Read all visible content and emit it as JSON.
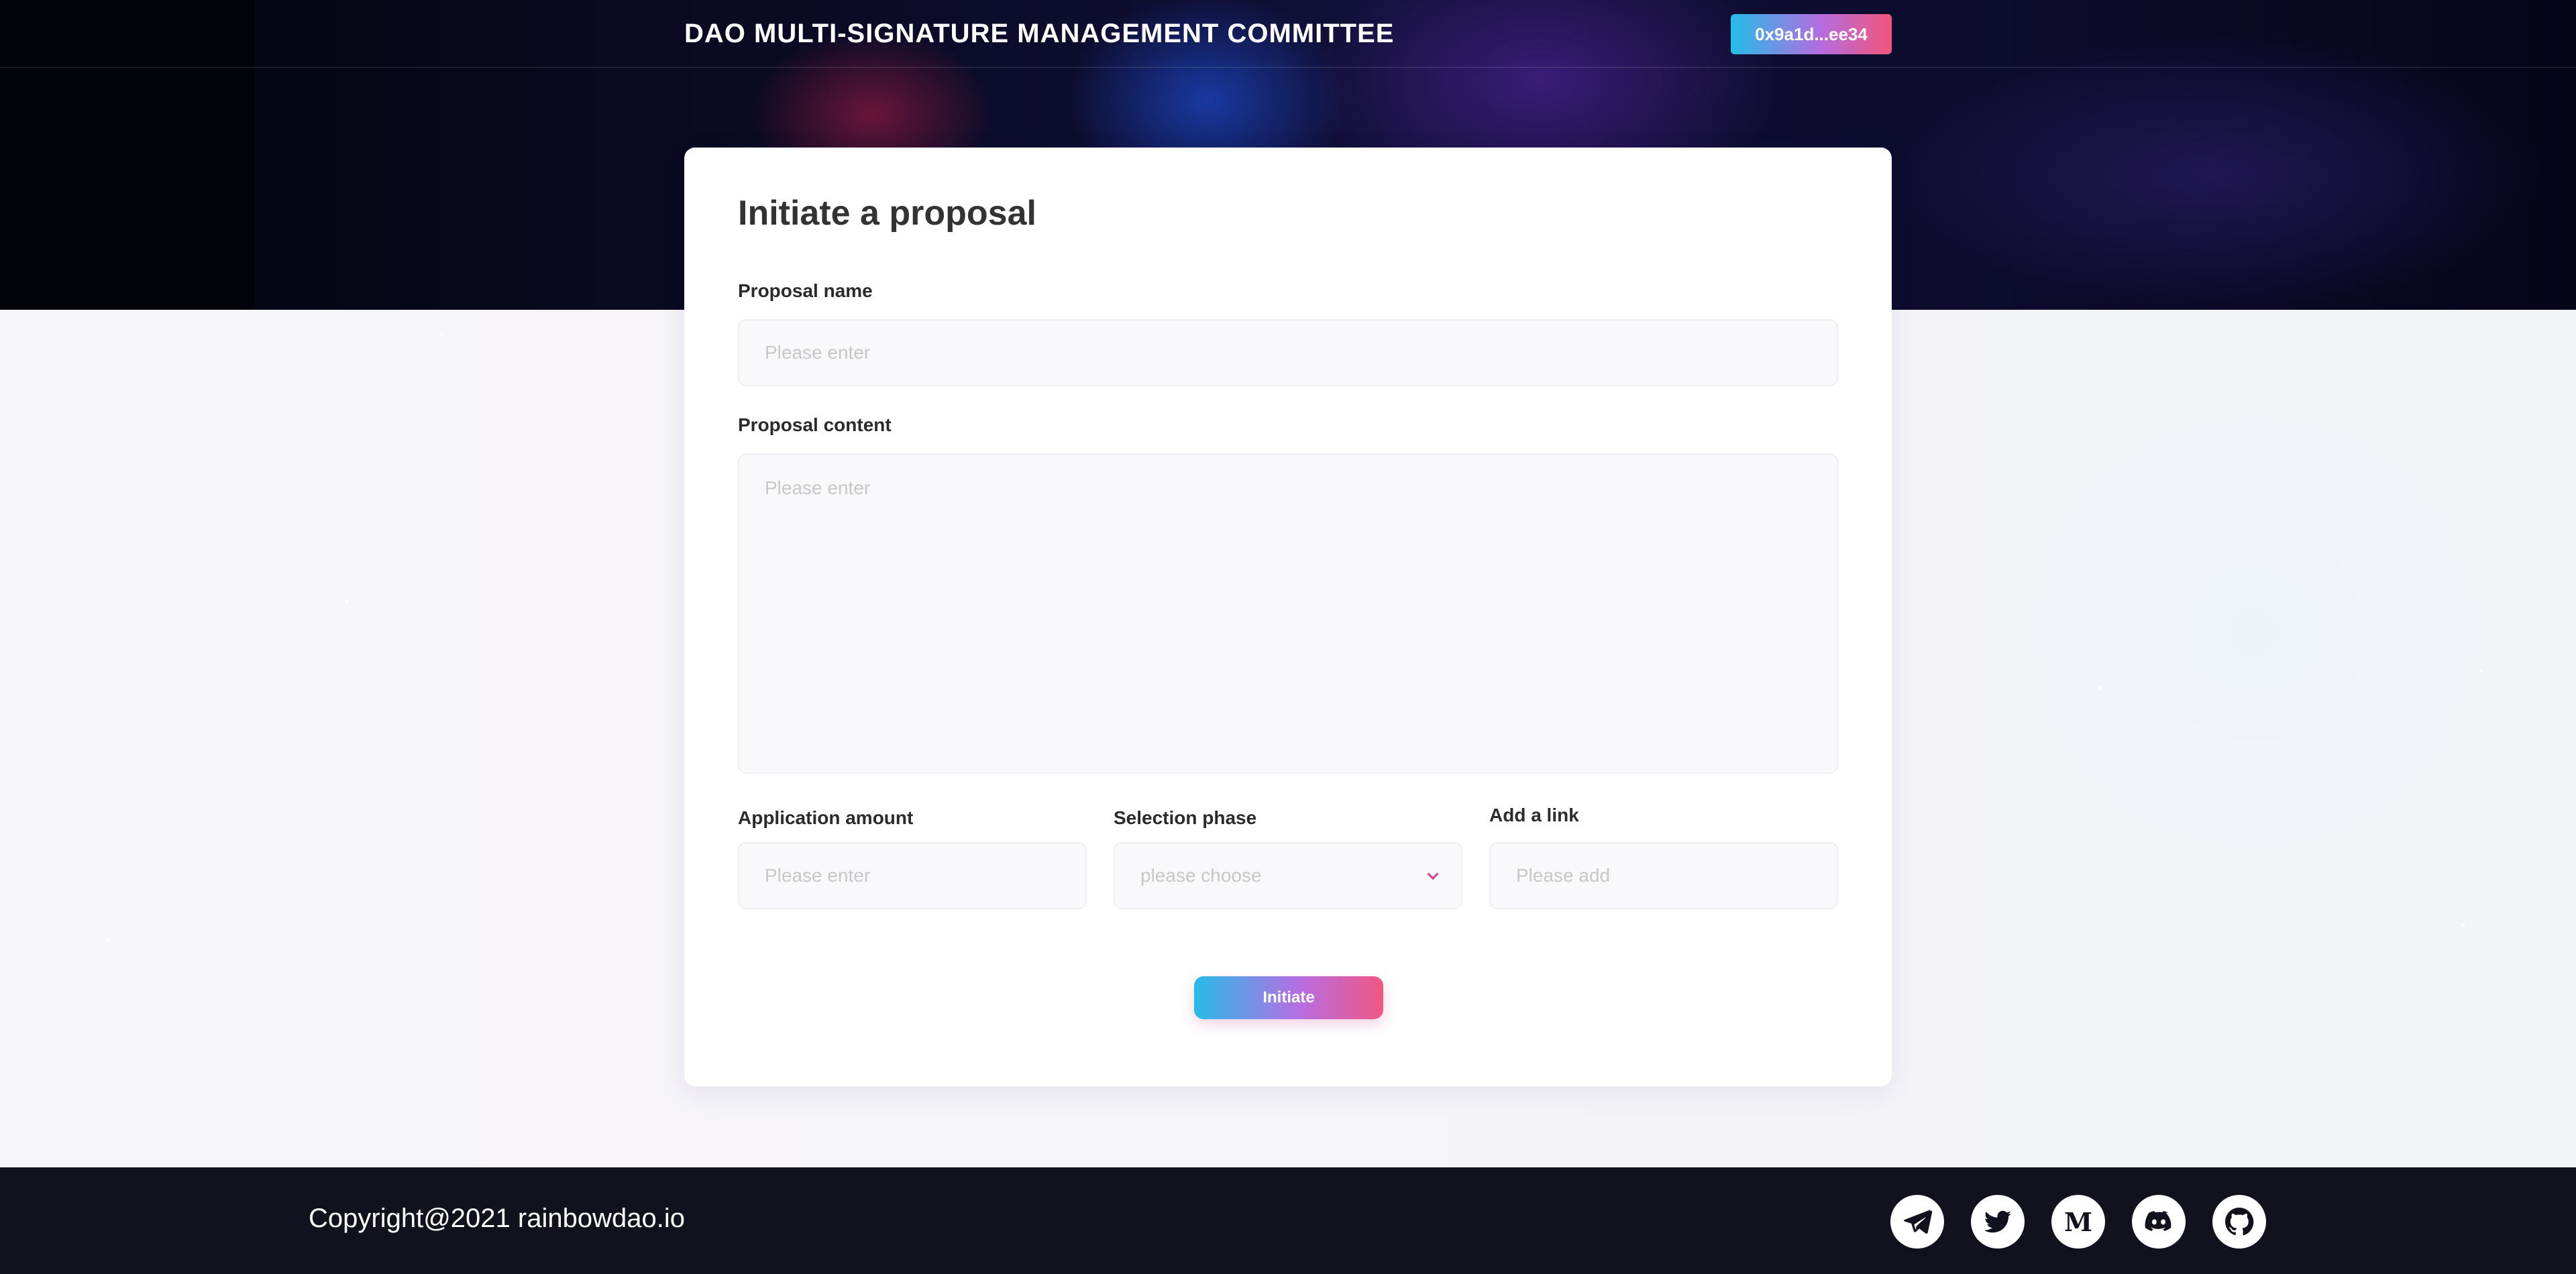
{
  "header": {
    "title": "DAO MULTI-SIGNATURE MANAGEMENT COMMITTEE",
    "wallet_address": "0x9a1d...ee34"
  },
  "form": {
    "title": "Initiate a proposal",
    "proposal_name": {
      "label": "Proposal name",
      "placeholder": "Please enter",
      "value": ""
    },
    "proposal_content": {
      "label": "Proposal content",
      "placeholder": "Please enter",
      "value": ""
    },
    "application_amount": {
      "label": "Application amount",
      "placeholder": "Please enter",
      "value": ""
    },
    "selection_phase": {
      "label": "Selection phase",
      "placeholder": "please choose",
      "value": ""
    },
    "add_link": {
      "label": "Add a link",
      "placeholder": "Please add",
      "value": ""
    },
    "submit_label": "Initiate"
  },
  "footer": {
    "copyright": "Copyright@2021 rainbowdao.io",
    "social_icons": [
      "telegram-icon",
      "twitter-icon",
      "medium-icon",
      "discord-icon",
      "github-icon"
    ]
  },
  "colors": {
    "accent_start": "#23bde8",
    "accent_mid": "#b36de0",
    "accent_end": "#f0557a",
    "footer_bg": "#12121f"
  }
}
